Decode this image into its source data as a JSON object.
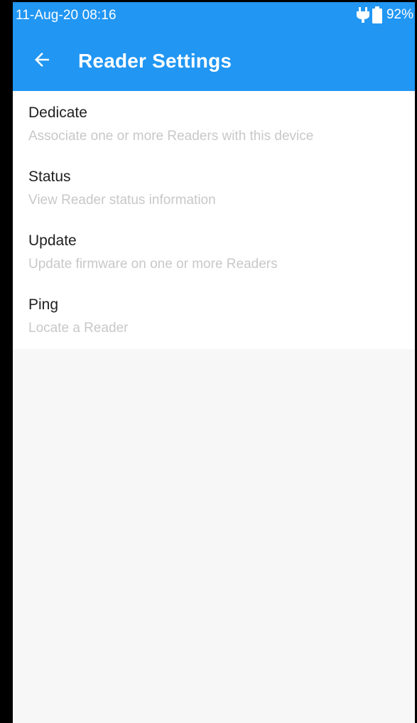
{
  "status_bar": {
    "time": "11-Aug-20 08:16",
    "battery_percent": "92%",
    "icons": [
      "plug-icon",
      "battery-icon"
    ]
  },
  "app_bar": {
    "title": "Reader Settings",
    "back_icon": "arrow-left-icon",
    "color": "#2196f3"
  },
  "settings": {
    "items": [
      {
        "title": "Dedicate",
        "subtitle": "Associate one or more Readers with this device"
      },
      {
        "title": "Status",
        "subtitle": "View Reader status information"
      },
      {
        "title": "Update",
        "subtitle": "Update firmware on one or more Readers"
      },
      {
        "title": "Ping",
        "subtitle": "Locate a Reader"
      }
    ]
  }
}
